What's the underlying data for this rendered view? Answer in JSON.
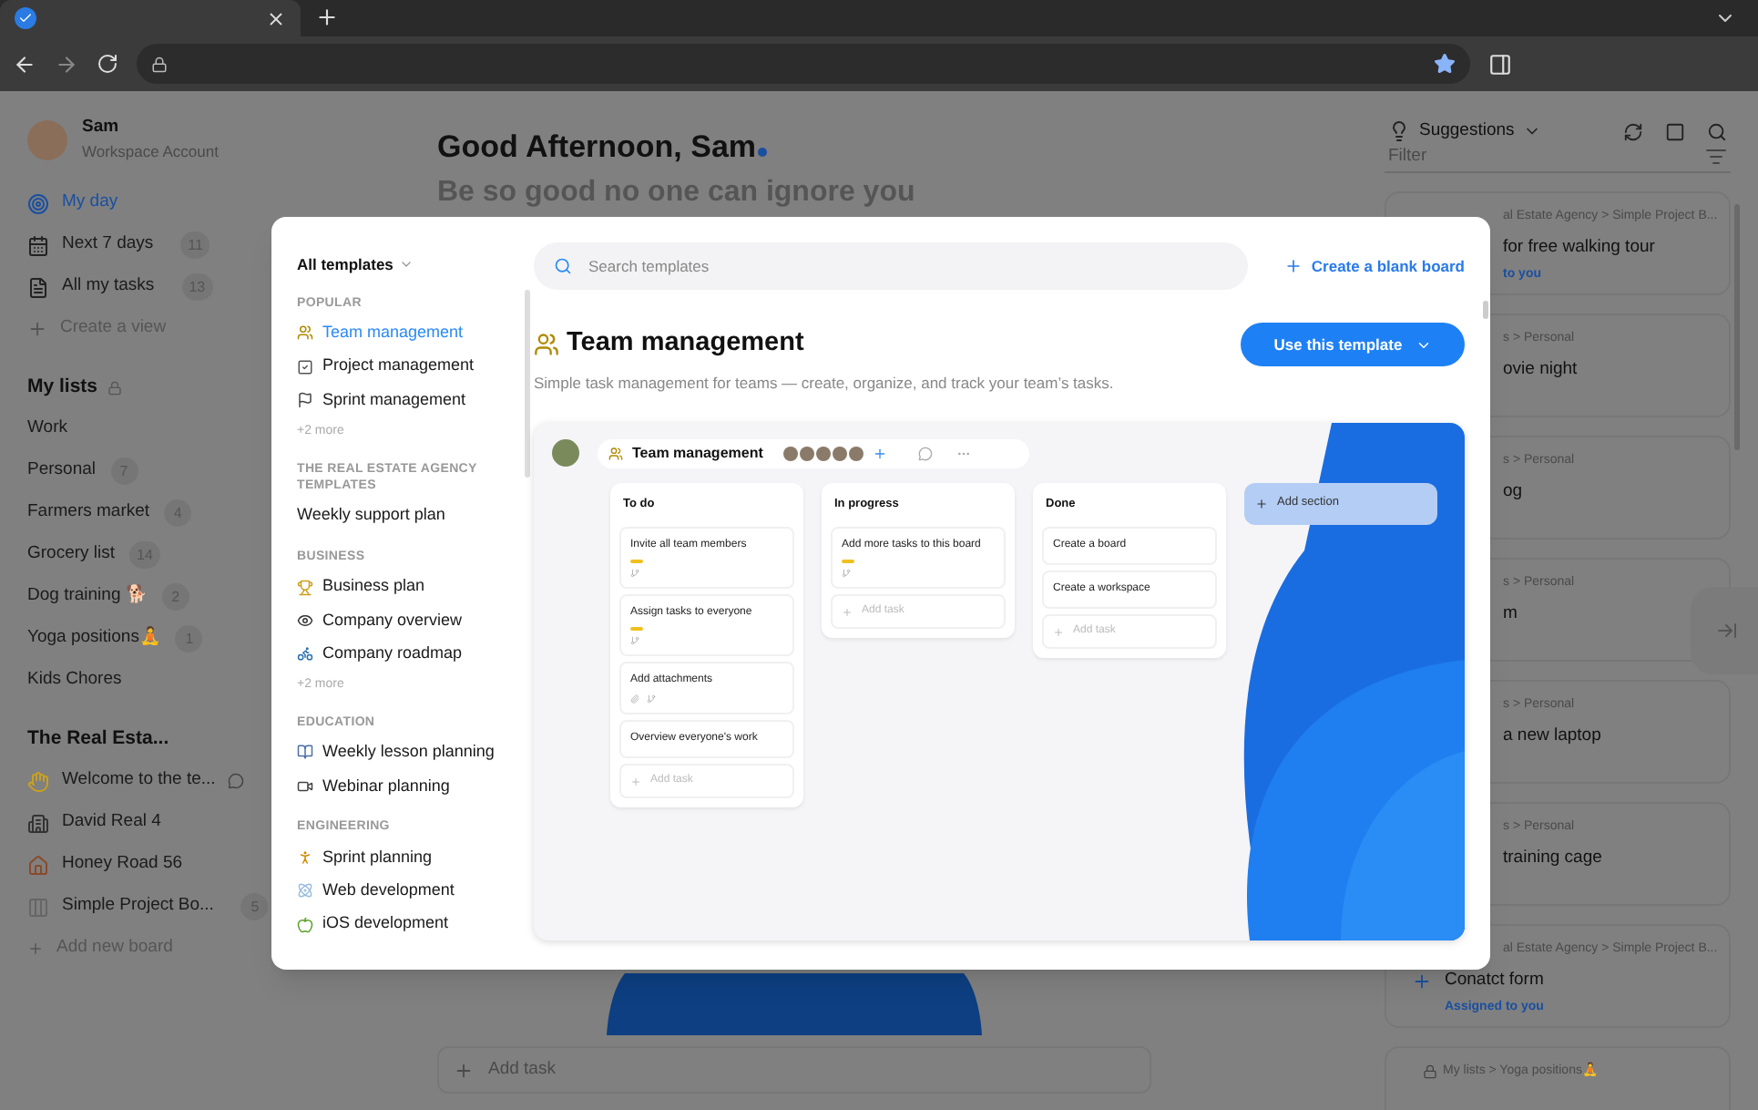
{
  "sidebar": {
    "user": {
      "name": "Sam",
      "subtitle": "Workspace Account"
    },
    "nav": [
      {
        "label": "My day",
        "selected": true
      },
      {
        "label": "Next 7 days",
        "count": "11",
        "selected": false
      },
      {
        "label": "All my tasks",
        "count": "13",
        "selected": false
      }
    ],
    "create_view": "Create a view",
    "lists_title": "My lists",
    "lists": [
      {
        "label": "Work"
      },
      {
        "label": "Personal",
        "count": "7"
      },
      {
        "label": "Farmers market",
        "count": "4"
      },
      {
        "label": "Grocery list",
        "count": "14"
      },
      {
        "label": "Dog training 🐕",
        "count": "2"
      },
      {
        "label": "Yoga positions🧘",
        "count": "1"
      },
      {
        "label": "Kids Chores"
      }
    ],
    "workspace_title": "The Real Esta...",
    "boards": [
      {
        "label": "Welcome to the te...",
        "comments": true
      },
      {
        "label": "David Real 4",
        "comments": false
      },
      {
        "label": "Honey Road 56",
        "comments": false
      },
      {
        "label": "Simple Project Bo...",
        "count": "5",
        "comments": false
      }
    ],
    "add_board": "Add new board"
  },
  "main": {
    "greeting": "Good Afternoon, Sam",
    "quote": "Be so good no one can ignore you",
    "add_task": "Add task"
  },
  "suggestions": {
    "label": "Suggestions",
    "filter_placeholder": "Filter",
    "cards": [
      {
        "kind": "covered",
        "breadcrumb": "al Estate Agency > Simple Project B...",
        "title": "for free walking tour",
        "assignee": "to you"
      },
      {
        "kind": "covered",
        "breadcrumb": "s > Personal",
        "title": "ovie night"
      },
      {
        "kind": "covered",
        "breadcrumb": "s > Personal",
        "title": "og"
      },
      {
        "kind": "covered",
        "breadcrumb": "s > Personal",
        "title": "m"
      },
      {
        "kind": "covered",
        "breadcrumb": "s > Personal",
        "title": "a new laptop"
      },
      {
        "kind": "covered",
        "breadcrumb": "s > Personal",
        "title": "training cage"
      },
      {
        "kind": "add",
        "breadcrumb": "al Estate Agency > Simple Project B...",
        "title": "Conatct form",
        "assignee": "Assigned to you"
      },
      {
        "kind": "locked",
        "breadcrumb": "My lists > Yoga positions🧘"
      }
    ]
  },
  "modal": {
    "category_menu": "All templates",
    "sections": [
      {
        "title": "POPULAR",
        "items": [
          {
            "label": "Team management",
            "selected": true
          },
          {
            "label": "Project management",
            "selected": false
          },
          {
            "label": "Sprint management",
            "selected": false
          }
        ],
        "more": "+2 more"
      },
      {
        "title": "THE REAL ESTATE AGENCY TEMPLATES",
        "items": [
          {
            "label": "Weekly support plan",
            "selected": false
          }
        ]
      },
      {
        "title": "BUSINESS",
        "items": [
          {
            "label": "Business plan",
            "selected": false
          },
          {
            "label": "Company overview",
            "selected": false
          },
          {
            "label": "Company roadmap",
            "selected": false
          }
        ],
        "more": "+2 more"
      },
      {
        "title": "EDUCATION",
        "items": [
          {
            "label": "Weekly lesson planning",
            "selected": false
          },
          {
            "label": "Webinar planning",
            "selected": false
          }
        ]
      },
      {
        "title": "ENGINEERING",
        "items": [
          {
            "label": "Sprint planning",
            "selected": false
          },
          {
            "label": "Web development",
            "selected": false
          },
          {
            "label": "iOS development",
            "selected": false
          }
        ]
      }
    ],
    "search_placeholder": "Search templates",
    "create_blank": "Create a blank board",
    "template_title": "Team management",
    "template_description": "Simple task management for teams — create, organize, and track your team’s tasks.",
    "use_button": "Use this template",
    "preview": {
      "board_title": "Team management",
      "add_section": "Add section",
      "columns": [
        {
          "title": "To do",
          "add_task": "Add task",
          "tasks": [
            {
              "title": "Invite all team members",
              "priority": true,
              "attachment": false,
              "subtasks": true
            },
            {
              "title": "Assign tasks to everyone",
              "priority": true,
              "attachment": false,
              "subtasks": true
            },
            {
              "title": "Add attachments",
              "priority": false,
              "attachment": true,
              "subtasks": true
            },
            {
              "title": "Overview everyone's work",
              "priority": false,
              "attachment": false,
              "subtasks": false
            }
          ]
        },
        {
          "title": "In progress",
          "add_task": "Add task",
          "tasks": [
            {
              "title": "Add more tasks to this board",
              "priority": true,
              "attachment": false,
              "subtasks": true
            }
          ]
        },
        {
          "title": "Done",
          "add_task": "Add task",
          "tasks": [
            {
              "title": "Create a board",
              "priority": false,
              "attachment": false,
              "subtasks": false
            },
            {
              "title": "Create a workspace",
              "priority": false,
              "attachment": false,
              "subtasks": false
            }
          ]
        }
      ]
    }
  }
}
